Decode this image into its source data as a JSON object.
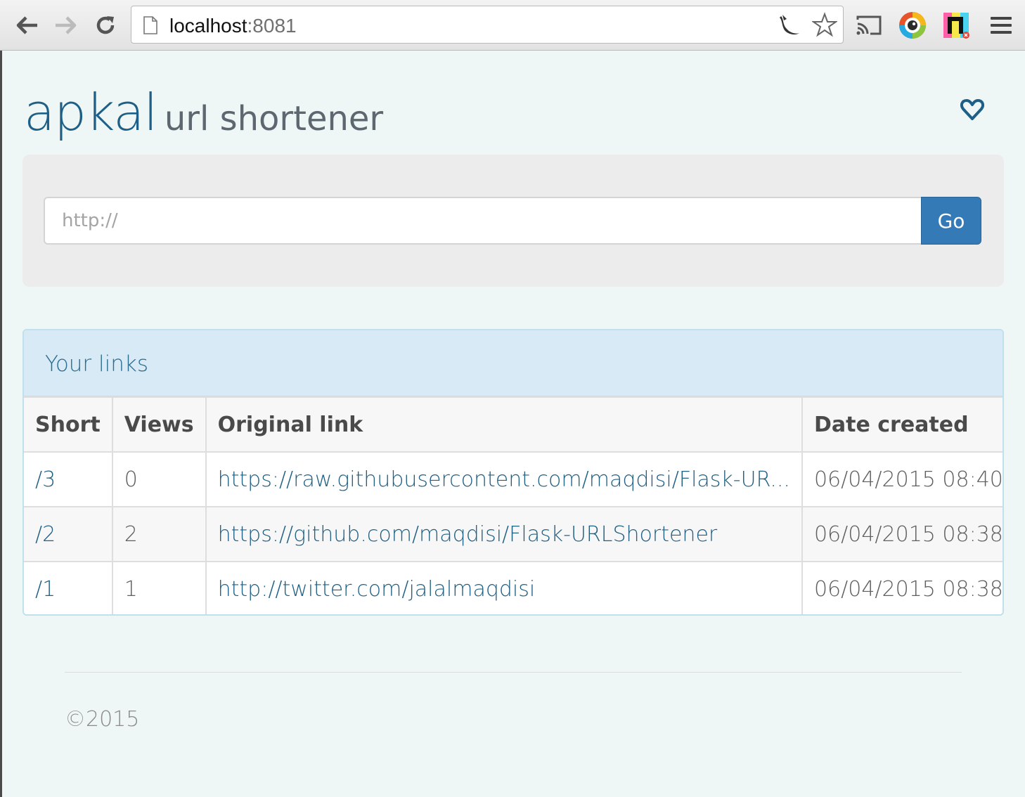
{
  "browser": {
    "url_host": "localhost",
    "url_port": ":8081",
    "icons": [
      "back-arrow-icon",
      "forward-arrow-icon",
      "reload-icon",
      "page-icon",
      "extension-icon",
      "bookmark-star-icon",
      "cast-icon",
      "color-picker-icon",
      "extension-icon",
      "menu-icon"
    ]
  },
  "header": {
    "brand": "apkal",
    "subtitle": "url shortener"
  },
  "form": {
    "placeholder": "http://",
    "go_label": "Go"
  },
  "links_panel": {
    "title": "Your links",
    "columns": [
      "Short",
      "Views",
      "Original link",
      "Date created"
    ],
    "rows": [
      {
        "short": "/3",
        "views": "0",
        "original": "https://raw.githubusercontent.com/maqdisi/Flask-UR...",
        "date": "06/04/2015 08:40"
      },
      {
        "short": "/2",
        "views": "2",
        "original": "https://github.com/maqdisi/Flask-URLShortener",
        "date": "06/04/2015 08:38"
      },
      {
        "short": "/1",
        "views": "1",
        "original": "http://twitter.com/jalalmaqdisi",
        "date": "06/04/2015 08:38"
      }
    ]
  },
  "footer": {
    "copyright": "©2015"
  },
  "colors": {
    "brand": "#1d5f86",
    "button": "#337ab7",
    "panel_heading": "#d7eaf5",
    "link": "#1e5f84"
  }
}
